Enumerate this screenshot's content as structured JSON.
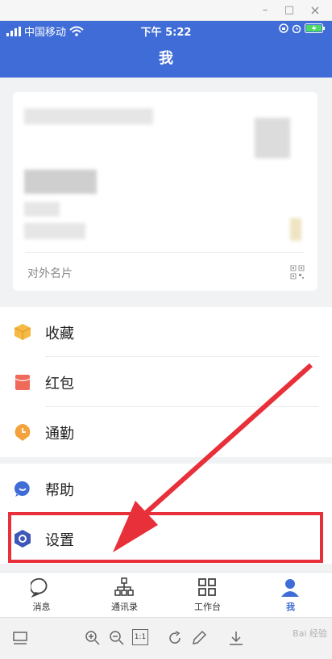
{
  "window": {
    "minimize_label": "–",
    "maximize_label": "□",
    "close_label": "×"
  },
  "status_bar": {
    "carrier": "中国移动",
    "time": "下午 5:22"
  },
  "header": {
    "title": "我"
  },
  "profile_card": {
    "footer_label": "对外名片"
  },
  "menu": {
    "group1": [
      {
        "label": "收藏",
        "icon": "favorites-icon",
        "color": "#f5b945"
      },
      {
        "label": "红包",
        "icon": "red-envelope-icon",
        "color": "#f06a5a"
      },
      {
        "label": "通勤",
        "icon": "commute-icon",
        "color": "#f3a23c"
      }
    ],
    "group2": [
      {
        "label": "帮助",
        "icon": "help-icon",
        "color": "#3f6cd6"
      },
      {
        "label": "设置",
        "icon": "settings-icon",
        "color": "#3f57b8"
      }
    ]
  },
  "tabs": [
    {
      "label": "消息",
      "icon": "message-icon"
    },
    {
      "label": "通讯录",
      "icon": "contacts-icon"
    },
    {
      "label": "工作台",
      "icon": "workbench-icon"
    },
    {
      "label": "我",
      "icon": "me-icon",
      "active": true
    }
  ],
  "viewer": {
    "zoom_reset_label": "1:1"
  },
  "watermark": "Bai 经验",
  "colors": {
    "brand": "#3f6cd6",
    "highlight": "#e8303a",
    "background": "#f1f2f4"
  }
}
